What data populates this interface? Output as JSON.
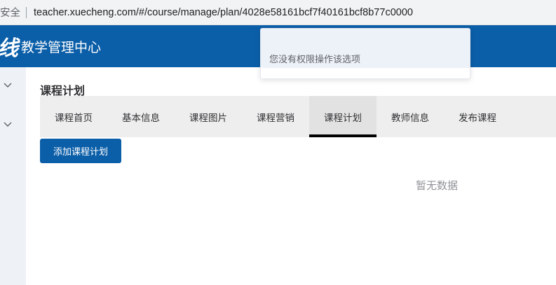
{
  "browser": {
    "security_text": "安全",
    "url": "teacher.xuecheng.com/#/course/manage/plan/4028e58161bcf7f40161bcf8b77c0000"
  },
  "header": {
    "logo_glyph": "线",
    "title": "教学管理中心",
    "bg_color": "#0b5ea8"
  },
  "popup": {
    "message": "您没有权限操作该选项"
  },
  "sidebar": {
    "items": [
      {
        "icon": "chevron-down-icon"
      },
      {
        "icon": "chevron-down-icon"
      }
    ]
  },
  "main": {
    "page_title": "课程计划",
    "tabs": [
      {
        "label": "课程首页",
        "active": false
      },
      {
        "label": "基本信息",
        "active": false
      },
      {
        "label": "课程图片",
        "active": false
      },
      {
        "label": "课程营销",
        "active": false
      },
      {
        "label": "课程计划",
        "active": true
      },
      {
        "label": "教师信息",
        "active": false
      },
      {
        "label": "发布课程",
        "active": false
      }
    ],
    "add_button_label": "添加课程计划",
    "empty_text": "暂无数据"
  }
}
